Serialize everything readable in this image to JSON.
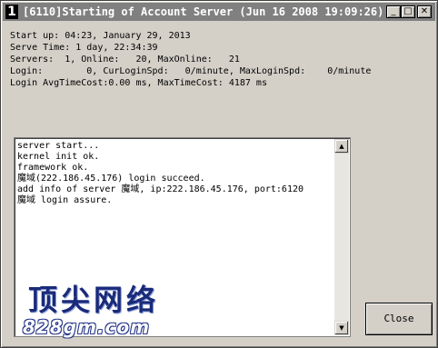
{
  "window": {
    "icon_label": "1",
    "title": "[6110]Starting of Account Server (Jun 16 2008 19:09:26)",
    "minimize_glyph": "_",
    "maximize_glyph": "□",
    "close_glyph": "✕"
  },
  "info": {
    "lines": [
      "Start up: 04:23, January 29, 2013",
      "Serve Time: 1 day, 22:34:39",
      "Servers:  1, Online:   20, MaxOnline:   21",
      "Login:        0, CurLoginSpd:   0/minute, MaxLoginSpd:    0/minute",
      "Login AvgTimeCost:0.00 ms, MaxTimeCost: 4187 ms"
    ]
  },
  "log": {
    "lines": [
      "server start...",
      "kernel init ok.",
      "framework ok.",
      "魔域(222.186.45.176) login succeed.",
      "add info of server 魔域, ip:222.186.45.176, port:6120",
      "魔域 login assure."
    ],
    "scroll_up_glyph": "▲",
    "scroll_down_glyph": "▼"
  },
  "watermark": {
    "chinese": "顶尖网络",
    "english": "828gm.com"
  },
  "buttons": {
    "close_label": "Close"
  }
}
